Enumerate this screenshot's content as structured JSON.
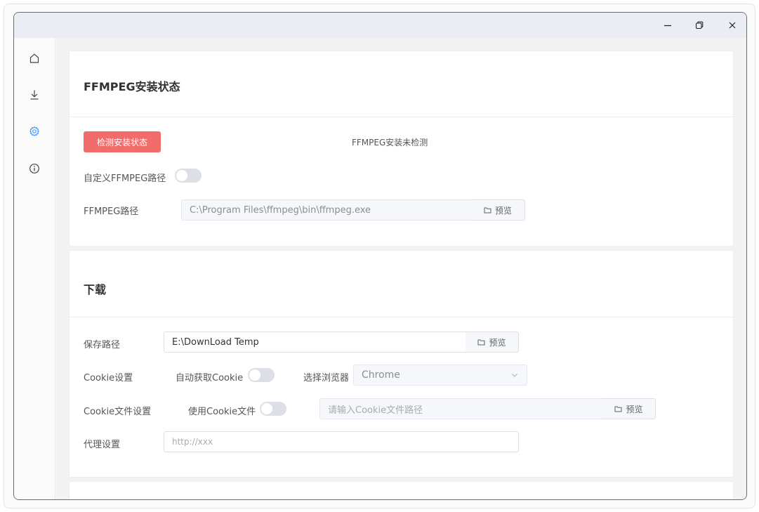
{
  "window": {
    "controls": {
      "minimize_icon": "minimize-icon",
      "maximize_icon": "restore-icon",
      "close_icon": "close-icon"
    }
  },
  "sidebar": {
    "items": [
      {
        "id": "home",
        "icon": "home-icon",
        "active": false
      },
      {
        "id": "download",
        "icon": "download-icon",
        "active": false
      },
      {
        "id": "settings",
        "icon": "gear-icon",
        "active": true
      },
      {
        "id": "about",
        "icon": "info-icon",
        "active": false
      }
    ],
    "active_color": "#409eff"
  },
  "ffmpeg": {
    "title": "FFMPEG安装状态",
    "check_button": "检测安装状态",
    "status": "FFMPEG安装未检测",
    "custom_path_label": "自定义FFMPEG路径",
    "custom_path_enabled": false,
    "path_label": "FFMPEG路径",
    "path_value": "C:\\Program Files\\ffmpeg\\bin\\ffmpeg.exe",
    "browse_button": "预览"
  },
  "download": {
    "title": "下载",
    "save_path_label": "保存路径",
    "save_path_value": "E:\\DownLoad Temp",
    "save_browse_button": "预览",
    "cookie_label": "Cookie设置",
    "auto_cookie_label": "自动获取Cookie",
    "auto_cookie_enabled": false,
    "browser_label": "选择浏览器",
    "browser_value": "Chrome",
    "cookie_file_label": "Cookie文件设置",
    "use_cookie_file_label": "使用Cookie文件",
    "use_cookie_file_enabled": false,
    "cookie_file_placeholder": "请输入Cookie文件路径",
    "cookie_browse_button": "预览",
    "proxy_label": "代理设置",
    "proxy_placeholder": "http://xxx"
  },
  "colors": {
    "danger_button": "#f36c6c",
    "switch_off": "#dcdfe6"
  }
}
